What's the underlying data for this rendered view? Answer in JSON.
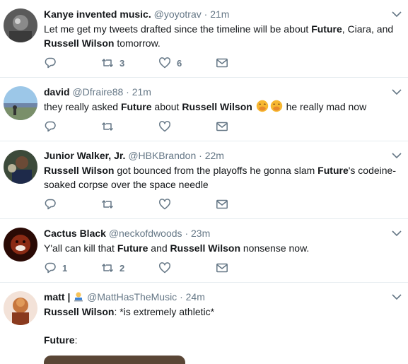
{
  "tweets": [
    {
      "name": "Kanye invented music.",
      "handle": "@yoyotrav",
      "time": "21m",
      "segments": [
        {
          "t": "Let me get my tweets drafted since the timeline will be about "
        },
        {
          "t": "Future",
          "b": true
        },
        {
          "t": ", Ciara, and "
        },
        {
          "t": "Russell Wilson",
          "b": true
        },
        {
          "t": " tomorrow."
        }
      ],
      "replies": "",
      "retweets": "3",
      "likes": "6"
    },
    {
      "name": "david",
      "handle": "@Dfraire88",
      "time": "21m",
      "segments": [
        {
          "t": "they really asked "
        },
        {
          "t": "Future",
          "b": true
        },
        {
          "t": " about "
        },
        {
          "t": "Russell Wilson",
          "b": true
        },
        {
          "t": " "
        },
        {
          "emoji": "hand-over-mouth"
        },
        {
          "emoji": "hand-over-mouth"
        },
        {
          "t": " he really mad now"
        }
      ],
      "replies": "",
      "retweets": "",
      "likes": ""
    },
    {
      "name": "Junior Walker, Jr.",
      "handle": "@HBKBrandon",
      "time": "22m",
      "segments": [
        {
          "t": "Russell Wilson",
          "b": true
        },
        {
          "t": " got bounced from the playoffs he gonna slam "
        },
        {
          "t": "Future",
          "b": true
        },
        {
          "t": "'s codeine-soaked corpse over the space needle"
        }
      ],
      "replies": "",
      "retweets": "",
      "likes": ""
    },
    {
      "name": "Cactus Black",
      "handle": "@neckofdwoods",
      "time": "23m",
      "segments": [
        {
          "t": "Y'all can kill that "
        },
        {
          "t": "Future",
          "b": true
        },
        {
          "t": " and "
        },
        {
          "t": "Russell Wilson",
          "b": true
        },
        {
          "t": " nonsense now."
        }
      ],
      "replies": "1",
      "retweets": "2",
      "likes": ""
    },
    {
      "name": "matt |",
      "name_emoji": "man-technologist",
      "handle": "@MattHasTheMusic",
      "time": "24m",
      "segments": [
        {
          "t": "Russell Wilson",
          "b": true
        },
        {
          "t": ": *is extremely athletic*"
        },
        {
          "br": true
        },
        {
          "br": true
        },
        {
          "t": "Future",
          "b": true
        },
        {
          "t": ":"
        }
      ],
      "replies": "",
      "retweets": "",
      "likes": "",
      "has_media": true
    }
  ],
  "ui": {
    "separator": "·"
  },
  "colors": {
    "border": "#e6ecf0",
    "secondary_text": "#657786",
    "primary_text": "#14171a",
    "icon": "#657786"
  }
}
